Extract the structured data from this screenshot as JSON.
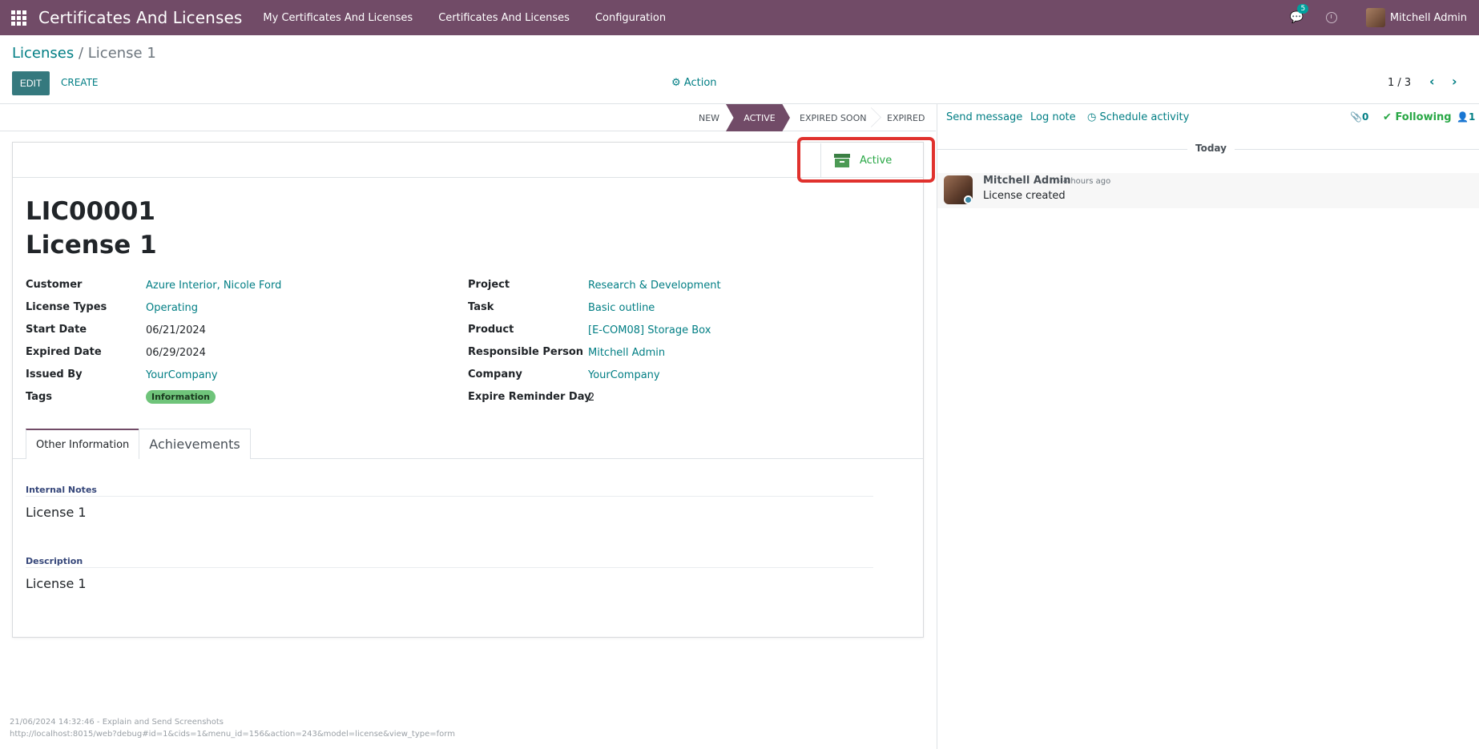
{
  "topbar": {
    "app_title": "Certificates And Licenses",
    "menus": [
      "My Certificates And Licenses",
      "Certificates And Licenses",
      "Configuration"
    ],
    "chat_count": "5",
    "user_name": "Mitchell Admin"
  },
  "control": {
    "breadcrumb_parent": "Licenses",
    "breadcrumb_sep": " / ",
    "breadcrumb_current": "License 1",
    "edit_label": "EDIT",
    "create_label": "CREATE",
    "action_label": "Action",
    "pager": "1 / 3"
  },
  "stages": [
    "NEW",
    "ACTIVE",
    "EXPIRED SOON",
    "EXPIRED"
  ],
  "smart_button": {
    "label": "Active"
  },
  "record": {
    "reference": "LIC00001",
    "name": "License 1",
    "left_fields": [
      {
        "label": "Customer",
        "value": "Azure Interior, Nicole Ford"
      },
      {
        "label": "License Types",
        "value": "Operating"
      },
      {
        "label": "Start Date",
        "value": "06/21/2024"
      },
      {
        "label": "Expired Date",
        "value": "06/29/2024"
      },
      {
        "label": "Issued By",
        "value": "YourCompany"
      },
      {
        "label": "Tags",
        "value": "Information"
      }
    ],
    "right_fields": [
      {
        "label": "Project",
        "value": "Research & Development"
      },
      {
        "label": "Task",
        "value": "Basic outline"
      },
      {
        "label": "Product",
        "value": "[E-COM08] Storage Box"
      },
      {
        "label": "Responsible Person",
        "value": "Mitchell Admin"
      },
      {
        "label": "Company",
        "value": "YourCompany"
      },
      {
        "label": "Expire Reminder Day",
        "value": "2"
      }
    ]
  },
  "tabs": [
    "Other Information",
    "Achievements"
  ],
  "other_info": {
    "notes_label": "Internal Notes",
    "notes_value": "License 1",
    "desc_label": "Description",
    "desc_value": "License 1"
  },
  "chatter": {
    "send_message": "Send message",
    "log_note": "Log note",
    "schedule_activity": "Schedule activity",
    "attachments": "0",
    "following": "Following",
    "followers": "1",
    "today": "Today",
    "message_author": "Mitchell Admin",
    "message_time": "- 4 hours ago",
    "message_body": "License created"
  },
  "footer": {
    "line1": "21/06/2024 14:32:46 - Explain and Send Screenshots",
    "line2": "http://localhost:8015/web?debug#id=1&cids=1&menu_id=156&action=243&model=license&view_type=form"
  },
  "colors": {
    "brand": "#714b67",
    "link": "#017e84",
    "edit_button": "#35797e",
    "success": "#28a745",
    "highlight": "#e0312d"
  }
}
